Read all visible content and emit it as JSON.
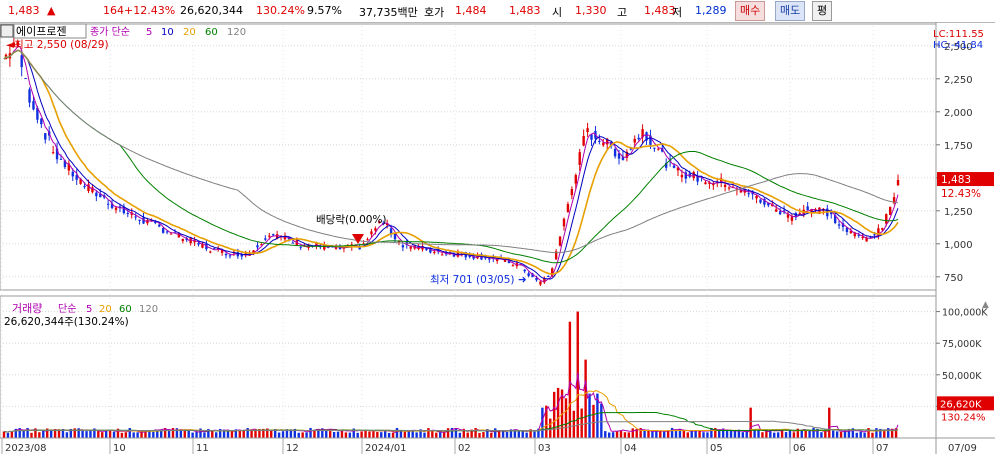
{
  "ticker": {
    "price": "1,483",
    "change_arrow": "▲",
    "change": "164",
    "change_pct": "+12.43%",
    "volume": "26,620,344",
    "volume_ratio": "130.24%",
    "turnover": "9.57%",
    "amount": "37,735백만",
    "quote_label": "호가",
    "ask": "1,484",
    "bid": "1,483",
    "open_label": "시",
    "open": "1,330",
    "high_label": "고",
    "high": "1,483",
    "low_label": "저",
    "low": "1,289",
    "buy_button": "매수",
    "sell_button": "매도",
    "flat_button": "평"
  },
  "colors": {
    "up": "#e00000",
    "down": "#1030e0",
    "ma5": "#b000b0",
    "ma10": "#0000c0",
    "ma20": "#e8a000",
    "ma60": "#008000",
    "ma120": "#808080"
  },
  "chart_data": [
    {
      "type": "candlestick",
      "title": "에이프로젠",
      "legend": {
        "label": "종가 단순",
        "periods": [
          "5",
          "10",
          "20",
          "60",
          "120"
        ]
      },
      "yticks": [
        2500,
        2250,
        2000,
        1750,
        1500,
        1250,
        1000,
        750
      ],
      "ytick_labels": [
        "2,500",
        "2,250",
        "2,000",
        "1,750",
        "1,500",
        "1,250",
        "1,000",
        "750"
      ],
      "ylim": [
        650,
        2650
      ],
      "top_right_labels": [
        "LC:111.55",
        "HC:-41.84"
      ],
      "last_price_label": "1,483",
      "last_change_label": "12.43%",
      "annotations": {
        "high": "최고 2,550 (08/29)",
        "low": "최저 701 (03/05)",
        "dividend": "배당락(0.00%)"
      },
      "xticks": [
        "2023/08",
        "10",
        "11",
        "12",
        "2024/01",
        "02",
        "03",
        "04",
        "05",
        "06",
        "07",
        "07/09"
      ],
      "key_points": [
        {
          "date": "2023/08/29",
          "close": 2550
        },
        {
          "date": "2023/09",
          "close": 1700
        },
        {
          "date": "2023/10",
          "close": 1200
        },
        {
          "date": "2023/11",
          "close": 920
        },
        {
          "date": "2023/12",
          "close": 1000
        },
        {
          "date": "2024/01",
          "close": 1100
        },
        {
          "date": "2024/02",
          "close": 900
        },
        {
          "date": "2024/03/05",
          "close": 701
        },
        {
          "date": "2024/03",
          "close": 1850
        },
        {
          "date": "2024/04",
          "close": 1600
        },
        {
          "date": "2024/05",
          "close": 1450
        },
        {
          "date": "2024/06",
          "close": 1200
        },
        {
          "date": "2024/07",
          "close": 1060
        },
        {
          "date": "2024/07/09",
          "close": 1483
        }
      ]
    },
    {
      "type": "bar",
      "title": "거래량",
      "legend": {
        "label": "단순",
        "periods": [
          "5",
          "20",
          "60",
          "120"
        ]
      },
      "value_label": "26,620,344주(130.24%)",
      "yticks": [
        100000,
        75000,
        50000,
        25000
      ],
      "ytick_labels": [
        "100,000K",
        "75,000K",
        "50,000K",
        "25,000K"
      ],
      "ylim": [
        0,
        106000
      ],
      "last_volume_label": "26,620K",
      "last_ratio_label": "130.24%"
    }
  ]
}
